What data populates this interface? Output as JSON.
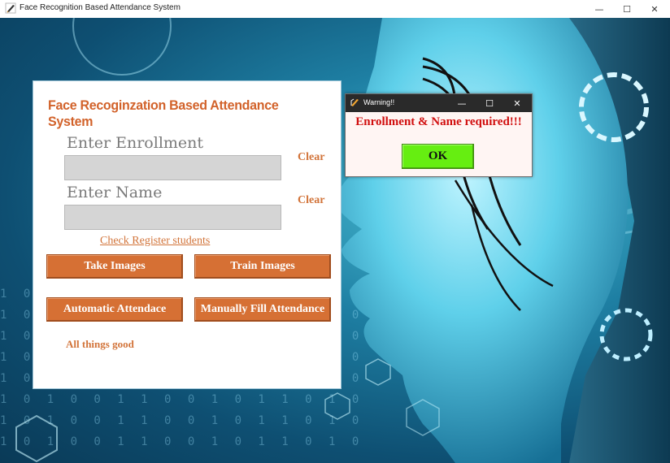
{
  "window": {
    "title": "Face Recognition Based Attendance System",
    "controls": {
      "minimize": "—",
      "maximize": "☐",
      "close": "✕"
    }
  },
  "panel": {
    "heading": "Face Recoginzation Based Attendance System",
    "enrollment_label": "Enter Enrollment",
    "enrollment_value": "",
    "name_label": "Enter Name",
    "name_value": "",
    "clear_enrollment": "Clear",
    "clear_name": "Clear",
    "check_register_link": "Check Register students",
    "buttons": {
      "take_images": "Take Images",
      "train_images": "Train Images",
      "automatic_attendance": "Automatic Attendace",
      "manual_attendance": "Manually Fill Attendance"
    },
    "status": "All things good"
  },
  "dialog": {
    "title": "Warning!!",
    "message": "Enrollment & Name required!!!",
    "ok_label": "OK",
    "controls": {
      "minimize": "—",
      "maximize": "☐",
      "close": "✕"
    }
  },
  "background": {
    "digits_row": "1 0 1 0 0 1 1 0 0 1 0 1 1 0 1 0"
  },
  "colors": {
    "accent_orange": "#d67034",
    "ok_green": "#66ee11",
    "warning_red": "#d10f0f",
    "background_cyan": "#1e7fa3"
  },
  "icons": {
    "app": "pencil-feather-icon",
    "dialog": "tk-feather-icon"
  }
}
